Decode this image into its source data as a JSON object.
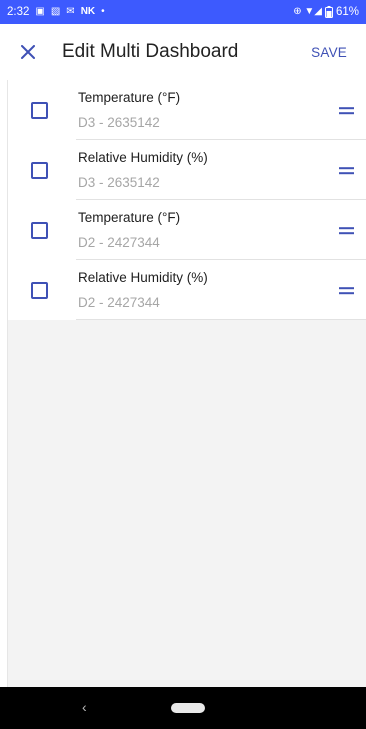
{
  "status_bar": {
    "time": "2:32",
    "left_icons": [
      "▣",
      "▧",
      "✉",
      "NK",
      "•"
    ],
    "right_icons": "⊕ ▼◢",
    "battery": "61%"
  },
  "app_bar": {
    "title": "Edit Multi Dashboard",
    "save_label": "SAVE",
    "close_icon": "close-icon"
  },
  "colors": {
    "accent": "#3f51b5",
    "status_bar": "#3d5afe",
    "subtitle": "#a6a6a6",
    "background_empty": "#f3f3f3"
  },
  "items": [
    {
      "title": "Temperature (°F)",
      "subtitle": "D3 - 2635142",
      "checked": false
    },
    {
      "title": "Relative Humidity (%)",
      "subtitle": "D3 - 2635142",
      "checked": false
    },
    {
      "title": "Temperature (°F)",
      "subtitle": "D2 - 2427344",
      "checked": false
    },
    {
      "title": "Relative Humidity (%)",
      "subtitle": "D2 - 2427344",
      "checked": false
    }
  ],
  "nav_bar": {
    "back_glyph": "‹"
  }
}
